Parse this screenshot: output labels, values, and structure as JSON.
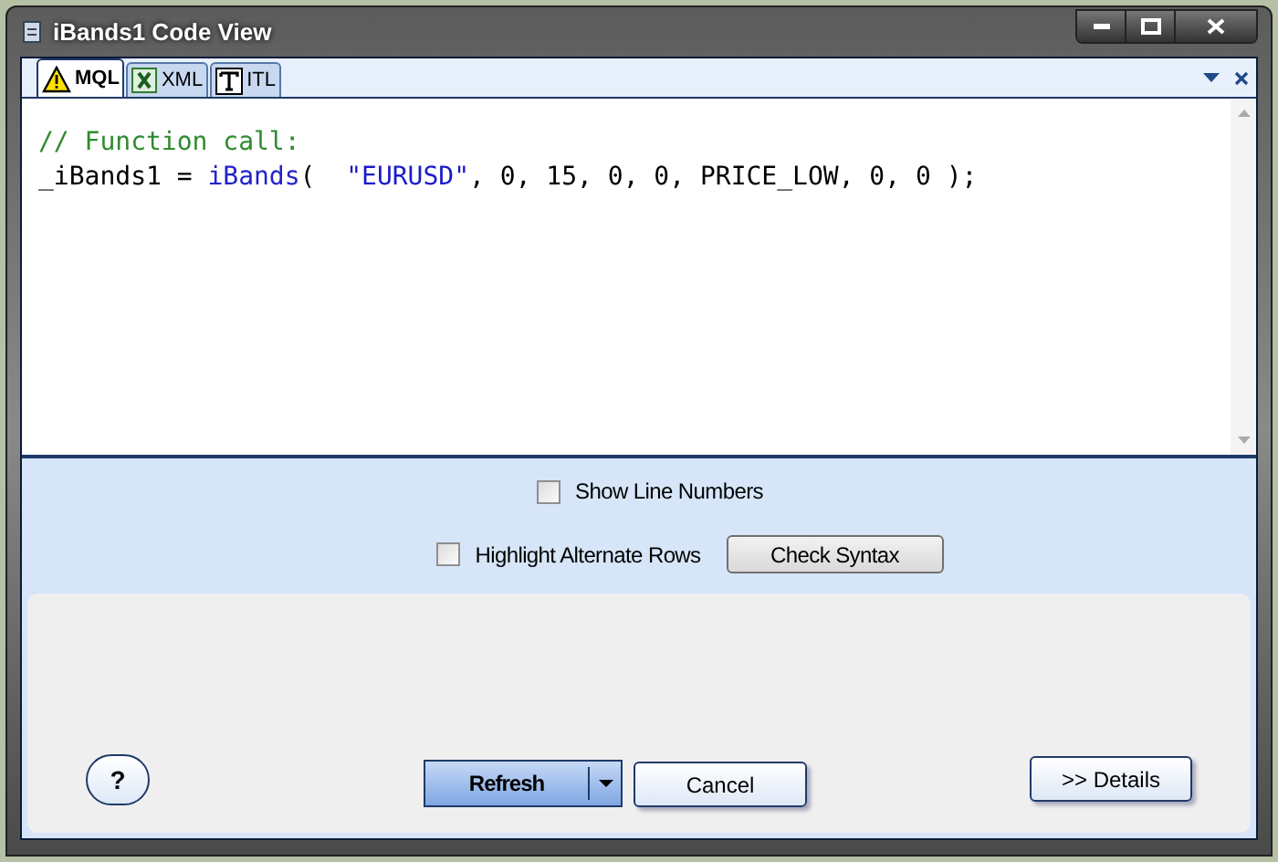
{
  "window": {
    "title": "iBands1 Code View"
  },
  "tabs": [
    {
      "label": "MQL",
      "kind": "warning",
      "selected": true
    },
    {
      "label": "XML",
      "kind": "excel",
      "selected": false
    },
    {
      "label": "ITL",
      "kind": "text",
      "selected": false
    }
  ],
  "code": {
    "lines": [
      {
        "tokens": [
          {
            "kind": "comment",
            "text": "// Function call:"
          }
        ]
      },
      {
        "tokens": [
          {
            "kind": "plain",
            "text": "_iBands1 = "
          },
          {
            "kind": "keyword",
            "text": "iBands"
          },
          {
            "kind": "plain",
            "text": "(  "
          },
          {
            "kind": "string",
            "text": "\"EURUSD\""
          },
          {
            "kind": "plain",
            "text": ", 0, 15, 0, 0, PRICE_LOW, 0, 0 );"
          }
        ]
      }
    ]
  },
  "options": {
    "show_line_numbers": {
      "label": "Show Line Numbers",
      "checked": false
    },
    "highlight_alternate_rows": {
      "label": "Highlight Alternate Rows",
      "checked": false
    },
    "check_syntax": "Check Syntax"
  },
  "buttons": {
    "help": "?",
    "refresh": "Refresh",
    "cancel": "Cancel",
    "details": ">> Details"
  }
}
